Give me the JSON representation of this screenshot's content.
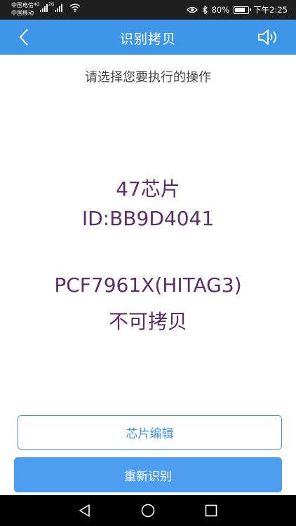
{
  "status_bar": {
    "carrier_1": "中国电信",
    "carrier_2": "中国移动",
    "network_1": "4G",
    "network_2": "2G",
    "battery": "80%",
    "battery_level": 0.8,
    "time": "下午2:25"
  },
  "app_bar": {
    "title": "识别拷贝",
    "back_icon": "chevron-left-icon",
    "sound_icon": "speaker-icon"
  },
  "prompt": "请选择您要执行的操作",
  "chip": {
    "name": "47芯片",
    "id": "ID:BB9D4041",
    "type": "PCF7961X(HITAG3)",
    "copy_status": "不可拷贝"
  },
  "buttons": {
    "edit": "芯片编辑",
    "reread": "重新识别"
  },
  "colors": {
    "accent": "#3f96e9",
    "chip_text": "#5b2e6a"
  }
}
